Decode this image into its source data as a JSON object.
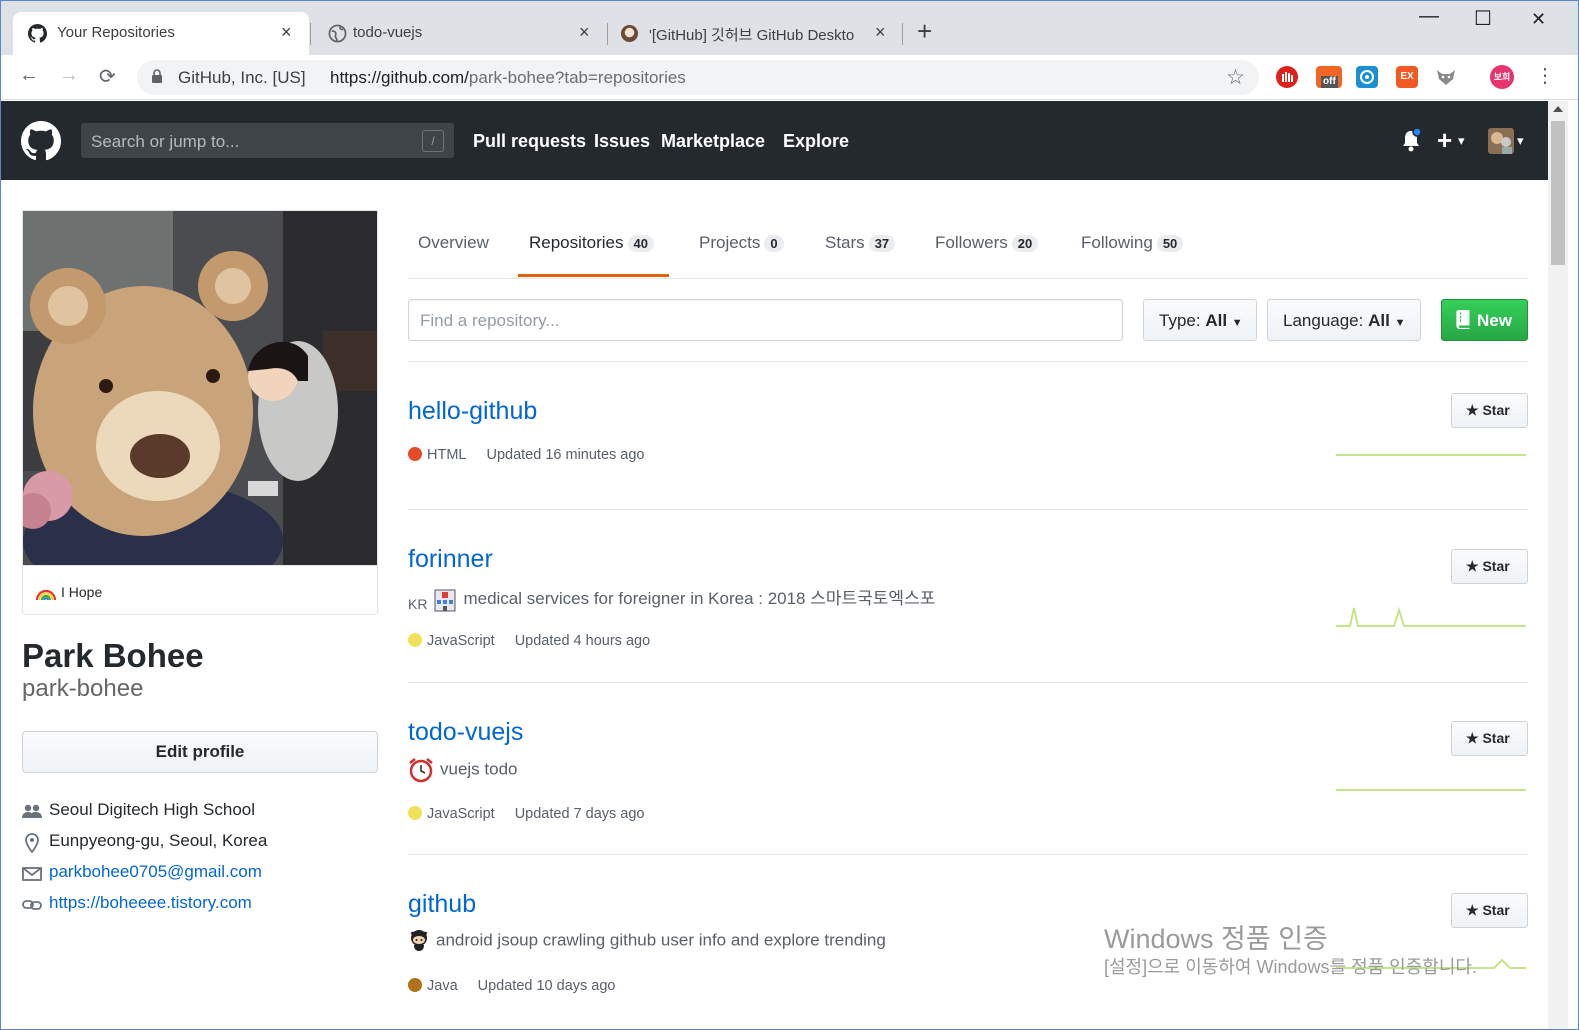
{
  "browser": {
    "tabs": [
      {
        "title": "Your Repositories",
        "close": "×"
      },
      {
        "title": "todo-vuejs",
        "close": "×"
      },
      {
        "title": "'[GitHub] 깃허브 GitHub Deskto",
        "close": "×"
      }
    ],
    "new_tab": "+",
    "window_controls": {
      "minimize": "—",
      "maximize": "☐",
      "close": "✕"
    },
    "nav": {
      "back": "←",
      "forward": "→",
      "reload": "⟳"
    },
    "org": "GitHub, Inc. [US]",
    "url_main": "https://github.com/",
    "url_rest": "park-bohee?tab=repositories",
    "bookmark": "☆",
    "extensions": [
      {
        "name": "adblock-extension",
        "color": "#e0201b",
        "label": ""
      },
      {
        "name": "price-off-extension",
        "color": "#f26522",
        "label": "off"
      },
      {
        "name": "capture-extension",
        "color": "#1b8fd3",
        "label": ""
      },
      {
        "name": "ex-extension",
        "color": "#f15a22",
        "label": "EX"
      },
      {
        "name": "fox-extension",
        "color": "#8a8a8a",
        "label": ""
      }
    ],
    "profile": {
      "label": "보희",
      "color": "#e8336d"
    },
    "menu": "⋮"
  },
  "github_header": {
    "search_placeholder": "Search or jump to...",
    "search_shortcut": "/",
    "nav": [
      "Pull requests",
      "Issues",
      "Marketplace",
      "Explore"
    ],
    "plus": "+",
    "caret": "▾"
  },
  "profile": {
    "status": "I Hope",
    "name": "Park Bohee",
    "login": "park-bohee",
    "edit_label": "Edit profile",
    "organization": "Seoul Digitech High School",
    "location": "Eunpyeong-gu, Seoul, Korea",
    "email": "parkbohee0705@gmail.com",
    "website": "https://boheeee.tistory.com"
  },
  "profile_tabs": [
    {
      "label": "Overview",
      "count": null
    },
    {
      "label": "Repositories",
      "count": "40"
    },
    {
      "label": "Projects",
      "count": "0"
    },
    {
      "label": "Stars",
      "count": "37"
    },
    {
      "label": "Followers",
      "count": "20"
    },
    {
      "label": "Following",
      "count": "50"
    }
  ],
  "filters": {
    "find_placeholder": "Find a repository...",
    "type_label": "Type:",
    "type_value": "All",
    "language_label": "Language:",
    "language_value": "All",
    "new_label": "New"
  },
  "repos": [
    {
      "name": "hello-github",
      "description": "",
      "description_prefix": "",
      "language": "HTML",
      "lang_color": "#e34c26",
      "updated": "Updated 16 minutes ago",
      "star_label": "Star"
    },
    {
      "name": "forinner",
      "description": "medical services for foreigner in Korea : 2018 스마트국토엑스포",
      "description_prefix": "KR",
      "language": "JavaScript",
      "lang_color": "#f1e05a",
      "updated": "Updated 4 hours ago",
      "star_label": "Star"
    },
    {
      "name": "todo-vuejs",
      "description": "vuejs todo",
      "description_prefix": "",
      "language": "JavaScript",
      "lang_color": "#f1e05a",
      "updated": "Updated 7 days ago",
      "star_label": "Star"
    },
    {
      "name": "github",
      "description": "android jsoup crawling github user info and explore trending",
      "description_prefix": "",
      "language": "Java",
      "lang_color": "#b07219",
      "updated": "Updated 10 days ago",
      "star_label": "Star"
    }
  ],
  "watermark": {
    "title": "Windows 정품 인증",
    "subtitle": "[설정]으로 이동하여 Windows를 정품 인증합니다."
  }
}
